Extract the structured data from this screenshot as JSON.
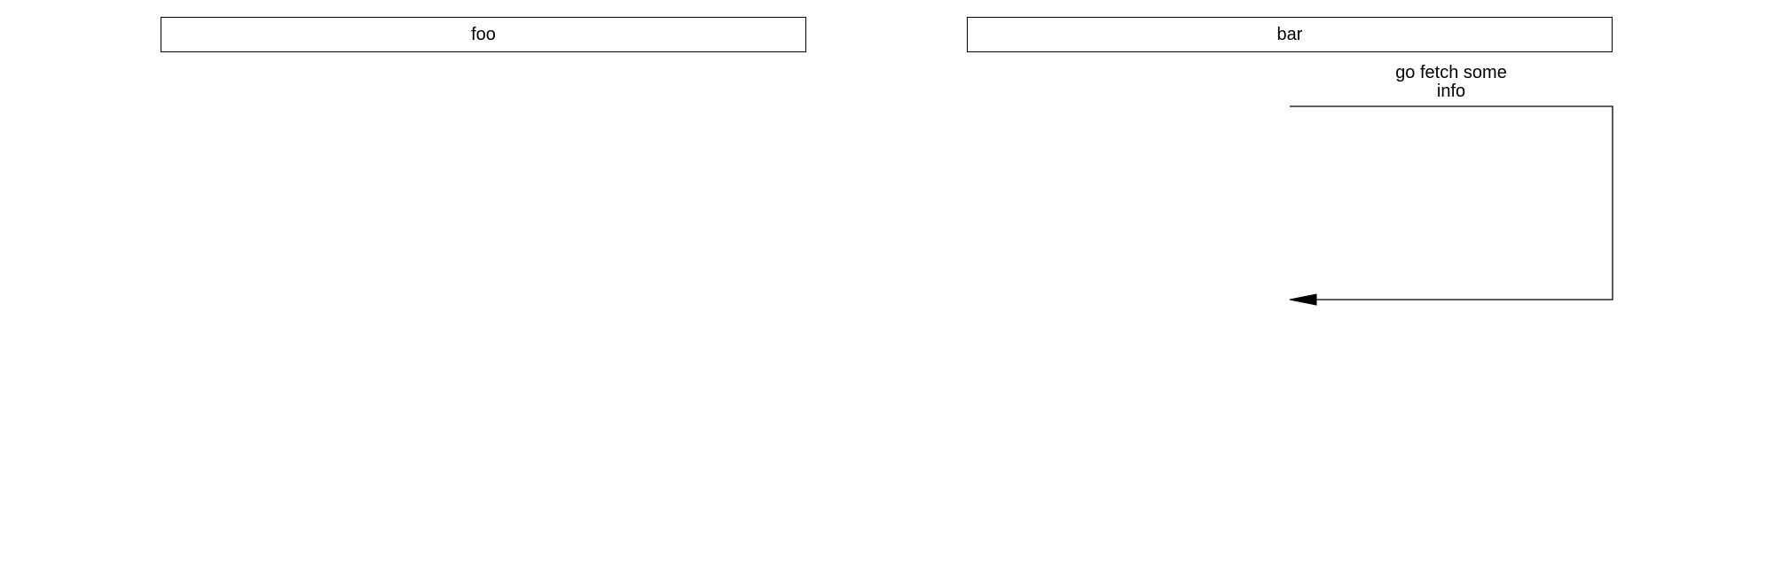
{
  "diagram": {
    "type": "sequence",
    "participants": [
      {
        "id": "foo",
        "label": "foo"
      },
      {
        "id": "bar",
        "label": "bar"
      }
    ],
    "messages": [
      {
        "from": "bar",
        "to": "bar",
        "label_lines": [
          "go fetch some",
          "info"
        ],
        "arrow": "filled",
        "style": "self-loop"
      }
    ],
    "colors": {
      "line": "#000000",
      "background": "#ffffff"
    }
  }
}
